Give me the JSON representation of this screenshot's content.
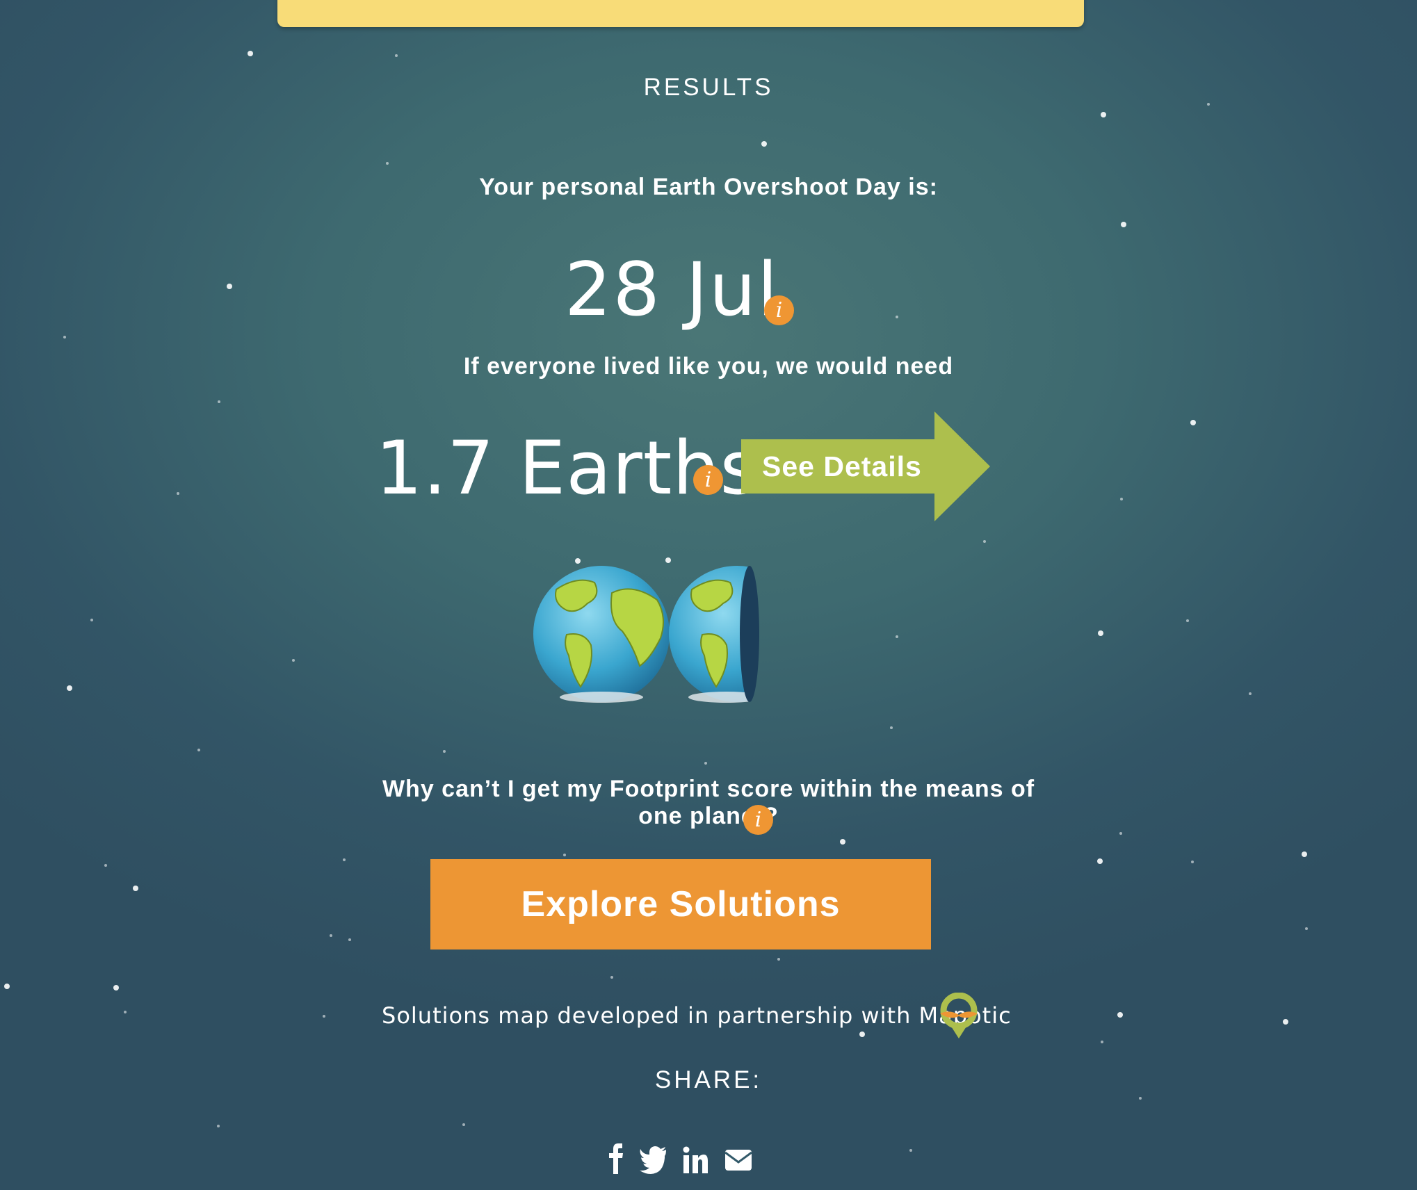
{
  "results": {
    "heading": "RESULTS",
    "overshoot_label": "Your personal Earth Overshoot Day is:",
    "overshoot_date": "28 Jul",
    "need_label": "If everyone lived like you, we would need",
    "earths_value": "1.7 Earths",
    "earths_count": 1.7,
    "see_details_label": "See Details",
    "why_label": "Why can’t I get my Footprint score within the means of one planet?",
    "explore_button": "Explore Solutions",
    "partner_text": "Solutions map developed in partnership with Mapotic",
    "share_label": "SHARE:",
    "info_glyph": "i"
  },
  "icons": {
    "info": "info-icon",
    "share": [
      "facebook-icon",
      "twitter-icon",
      "linkedin-icon",
      "email-icon"
    ],
    "partner": "mapotic-pin-icon"
  },
  "colors": {
    "accent_orange": "#ed9634",
    "details_green": "#adbf4d",
    "top_bar_yellow": "#f8dc78",
    "background": "#3e6a70"
  }
}
